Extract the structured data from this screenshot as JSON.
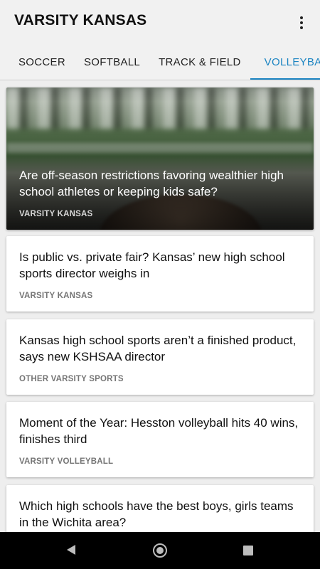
{
  "app": {
    "title": "VARSITY KANSAS",
    "menu_icon": "more-vert-icon"
  },
  "tabs": [
    {
      "label": "SOCCER",
      "active": false
    },
    {
      "label": "SOFTBALL",
      "active": false
    },
    {
      "label": "TRACK & FIELD",
      "active": false
    },
    {
      "label": "VOLLEYBALL",
      "active": true
    }
  ],
  "accent_color": "#1b84c2",
  "hero": {
    "title": "Are off-season restrictions favoring wealthier high school athletes or keeping kids safe?",
    "source": "VARSITY KANSAS"
  },
  "articles": [
    {
      "title": "Is public vs. private fair? Kansas’ new high school sports director weighs in",
      "source": "VARSITY KANSAS"
    },
    {
      "title": "Kansas high school sports aren’t a finished product, says new KSHSAA director",
      "source": "OTHER VARSITY SPORTS"
    },
    {
      "title": "Moment of the Year: Hesston volleyball hits 40 wins, finishes third",
      "source": "VARSITY VOLLEYBALL"
    },
    {
      "title": "Which high schools have the best boys, girls teams in the Wichita area?",
      "source": ""
    }
  ],
  "system_nav": {
    "back_icon": "back-triangle-icon",
    "home_icon": "home-circle-icon",
    "recents_icon": "recents-square-icon"
  }
}
